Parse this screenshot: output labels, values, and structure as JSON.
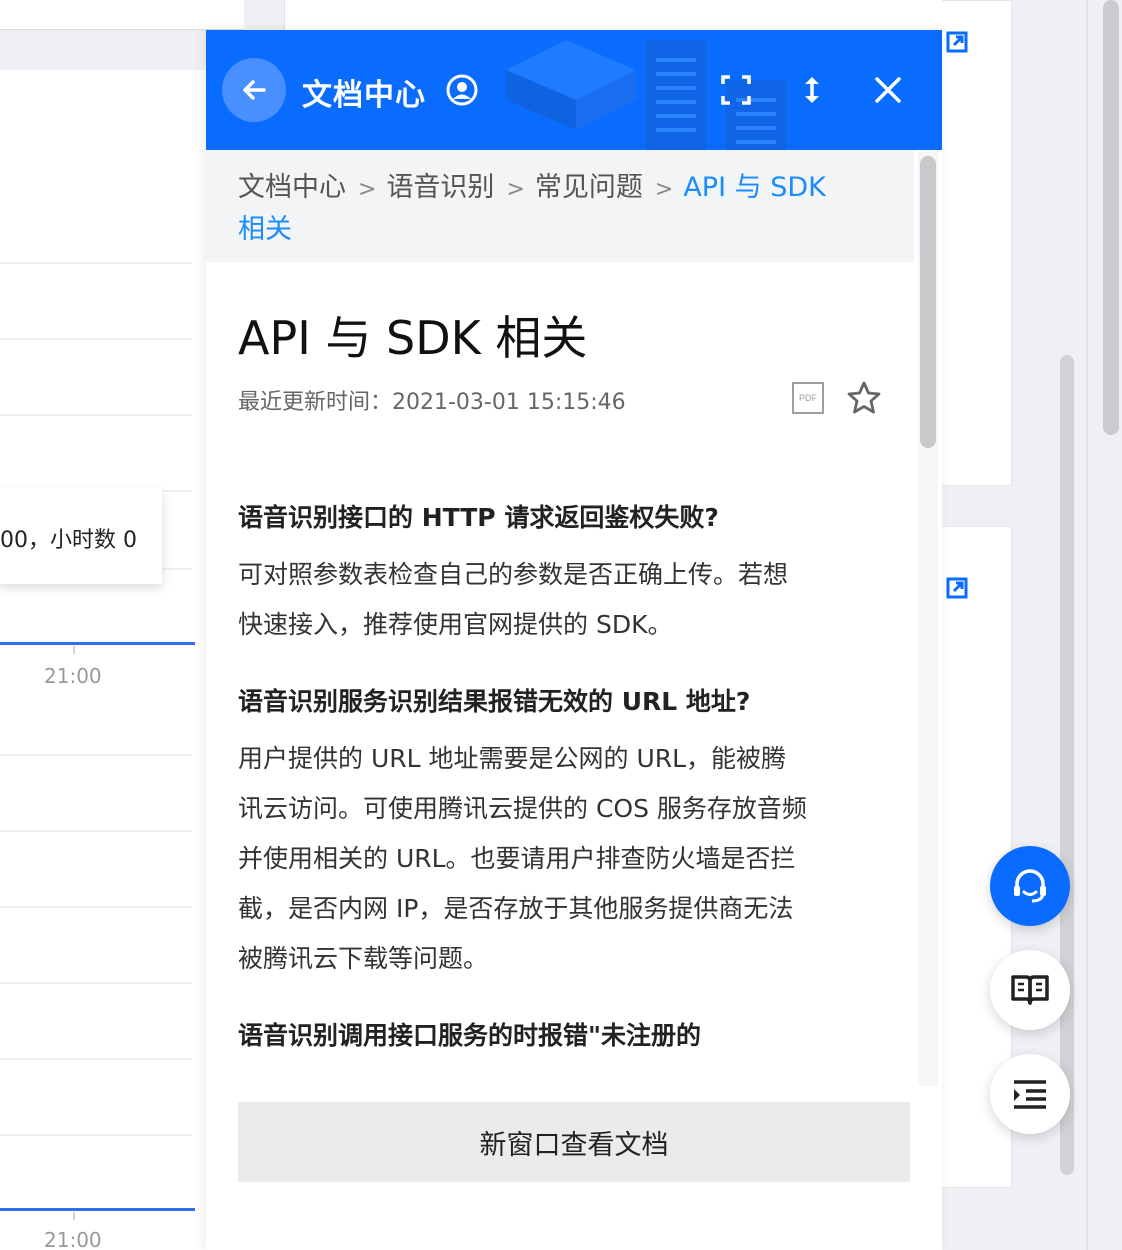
{
  "background": {
    "tooltip_text": "00，小时数 0",
    "axis_label_1": "21:00",
    "axis_label_2": "21:00"
  },
  "panel": {
    "header": {
      "title": "文档中心",
      "back_icon": "arrow-left-icon",
      "user_icon": "user-circle-icon",
      "expand_icon": "fullscreen-icon",
      "resize_icon": "vertical-resize-icon",
      "close_icon": "close-icon",
      "color": "#0a6cff"
    },
    "breadcrumb": {
      "items": [
        "文档中心",
        "语音识别",
        "常见问题"
      ],
      "current_line1": "API 与 SDK",
      "current_line2": "相关"
    },
    "doc": {
      "title": "API 与 SDK 相关",
      "updated": "最近更新时间：2021-03-01 15:15:46",
      "pdf_label": "PDF",
      "sections": [
        {
          "question": "语音识别接口的 HTTP 请求返回鉴权失败?",
          "answer_lines": [
            "可对照参数表检查自己的参数是否正确上传。若想",
            "快速接入，推荐使用官网提供的 SDK。"
          ]
        },
        {
          "question": "语音识别服务识别结果报错无效的 URL 地址?",
          "answer_lines": [
            "用户提供的 URL 地址需要是公网的 URL，能被腾",
            "讯云访问。可使用腾讯云提供的 COS 服务存放音频",
            "并使用相关的 URL。也要请用户排查防火墙是否拦",
            "截，是否内网 IP，是否存放于其他服务提供商无法",
            "被腾讯云下载等问题。"
          ]
        },
        {
          "question": "语音识别调用接口服务的时报错\"未注册的",
          "answer_lines": []
        }
      ]
    },
    "open_new_window": "新窗口查看文档"
  },
  "floating": {
    "support_icon": "headset-icon",
    "docs_icon": "book-icon",
    "toc_icon": "outline-icon"
  }
}
